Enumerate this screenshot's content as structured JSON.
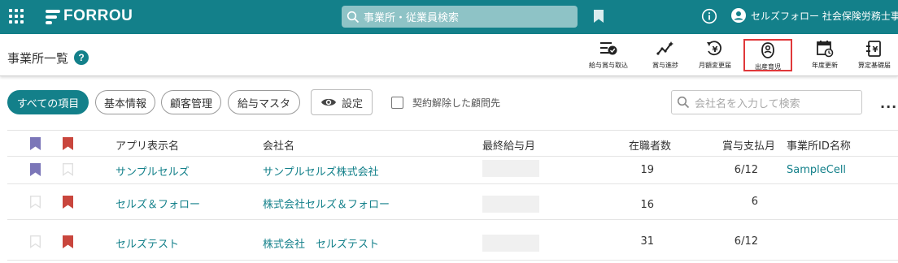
{
  "topbar": {
    "brand": "FORROU",
    "search_placeholder": "事業所・従業員検索",
    "user_name": "セルズフォロー 社会保険労務士事..."
  },
  "subbar": {
    "page_title": "事業所一覧",
    "help": "?",
    "tools": [
      {
        "label": "給与賞与取込",
        "icon": "import-icon"
      },
      {
        "label": "賞与進捗",
        "icon": "progress-icon"
      },
      {
        "label": "月額変更届",
        "icon": "yen-change-icon"
      },
      {
        "label": "出産育児",
        "icon": "baby-icon"
      },
      {
        "label": "年度更新",
        "icon": "calendar-refresh-icon"
      },
      {
        "label": "算定基礎届",
        "icon": "yen-document-icon"
      }
    ]
  },
  "filters": {
    "chips": [
      "すべての項目",
      "基本情報",
      "顧客管理",
      "給与マスタ"
    ],
    "settings": "設定",
    "checkbox_label": "契約解除した顧問先",
    "company_search_placeholder": "会社名を入力して検索",
    "more": "..."
  },
  "table": {
    "headers": [
      "アプリ表示名",
      "会社名",
      "最終給与月",
      "在職者数",
      "賞与支払月",
      "事業所ID名称"
    ],
    "rows": [
      {
        "app_name": "サンプルセルズ",
        "company": "サンプルセルズ株式会社",
        "employees": "19",
        "bonus_month": "6/12",
        "office_id": "SampleCell",
        "purple": true,
        "red": false
      },
      {
        "app_name": "セルズ＆フォロー",
        "company": "株式会社セルズ＆フォロー",
        "employees": "16",
        "bonus_month": "6",
        "office_id": "",
        "purple": false,
        "red": true
      },
      {
        "app_name": "セルズテスト",
        "company": "株式会社　セルズテスト",
        "employees": "31",
        "bonus_month": "6/12",
        "office_id": "",
        "purple": false,
        "red": true
      }
    ]
  },
  "colors": {
    "brand": "#13808a",
    "purple_bookmark": "#7b76b8",
    "red_bookmark": "#c9463d",
    "highlight": "#e0383a"
  }
}
